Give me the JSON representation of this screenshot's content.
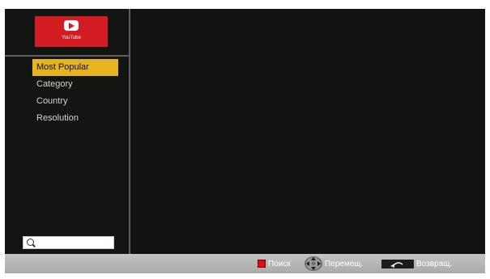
{
  "app": {
    "logo_text": "YouTube"
  },
  "sidebar": {
    "items": [
      {
        "label": "Most Popular",
        "selected": true
      },
      {
        "label": "Category",
        "selected": false
      },
      {
        "label": "Country",
        "selected": false
      },
      {
        "label": "Resolution",
        "selected": false
      }
    ],
    "search": {
      "value": "",
      "icon": "search-icon"
    }
  },
  "footer": {
    "hints": [
      {
        "icon": "red-key-icon",
        "label": "Поиск"
      },
      {
        "icon": "dpad-icon",
        "label": "Перемещ."
      },
      {
        "icon": "back-icon",
        "label": "Возвращ."
      }
    ]
  },
  "colors": {
    "background": "#0f120e",
    "selected_item": "#e6b321",
    "logo_red": "#d41d22",
    "footer": "#b5b7b5"
  }
}
